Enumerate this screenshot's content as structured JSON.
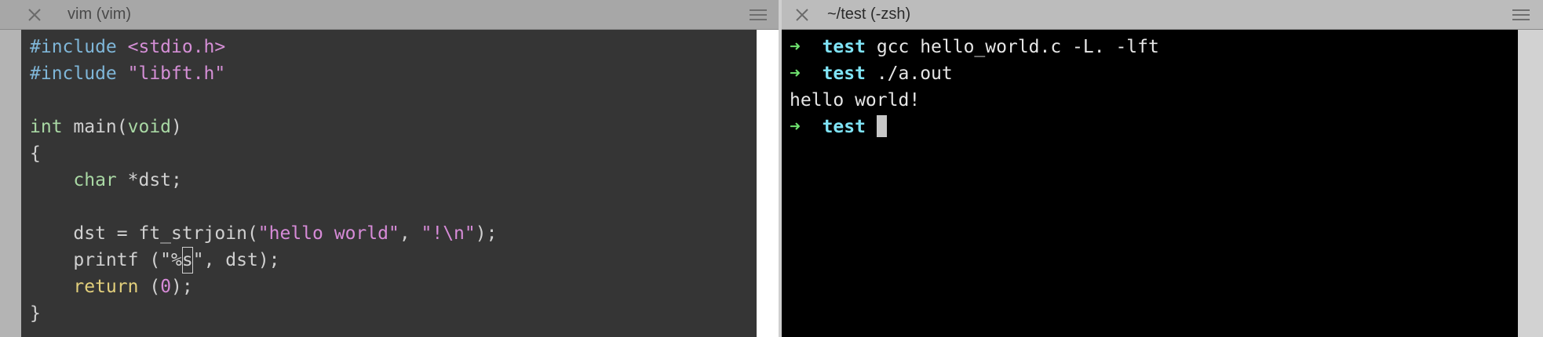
{
  "panes": {
    "left": {
      "tab_title": "vim (vim)",
      "lines": [
        [
          {
            "t": "#include ",
            "c": "pre"
          },
          {
            "t": "<stdio.h>",
            "c": "inc"
          }
        ],
        [
          {
            "t": "#include ",
            "c": "pre"
          },
          {
            "t": "\"libft.h\"",
            "c": "inc"
          }
        ],
        [],
        [
          {
            "t": "int",
            "c": "type"
          },
          {
            "t": " main(",
            "c": "plain"
          },
          {
            "t": "void",
            "c": "type"
          },
          {
            "t": ")",
            "c": "plain"
          }
        ],
        [
          {
            "t": "{",
            "c": "plain"
          }
        ],
        [
          {
            "t": "    ",
            "c": "plain"
          },
          {
            "t": "char",
            "c": "type"
          },
          {
            "t": " *dst;",
            "c": "plain"
          }
        ],
        [],
        [
          {
            "t": "    dst = ft_strjoin(",
            "c": "plain"
          },
          {
            "t": "\"hello world\"",
            "c": "str"
          },
          {
            "t": ", ",
            "c": "plain"
          },
          {
            "t": "\"!\\n\"",
            "c": "str"
          },
          {
            "t": ");",
            "c": "plain"
          }
        ],
        [
          {
            "t": "    printf (\"%",
            "c": "plain"
          },
          {
            "t": "s",
            "c": "cursor"
          },
          {
            "t": "\", dst);",
            "c": "plain"
          }
        ],
        [
          {
            "t": "    ",
            "c": "plain"
          },
          {
            "t": "return",
            "c": "kw"
          },
          {
            "t": " (",
            "c": "plain"
          },
          {
            "t": "0",
            "c": "num"
          },
          {
            "t": ");",
            "c": "plain"
          }
        ],
        [
          {
            "t": "}",
            "c": "plain"
          }
        ]
      ]
    },
    "right": {
      "tab_title": "~/test (-zsh)",
      "prompt_arrow": "➜",
      "prompt_dir": "test",
      "lines": [
        {
          "type": "prompt",
          "cmd": "gcc hello_world.c -L. -lft"
        },
        {
          "type": "prompt",
          "cmd": "./a.out"
        },
        {
          "type": "output",
          "text": "hello world!"
        },
        {
          "type": "prompt",
          "cmd": "",
          "cursor": true
        }
      ]
    }
  },
  "colors": {
    "editor_bg": "#353535",
    "terminal_bg": "#000000",
    "prompt_arrow": "#6ee06e",
    "prompt_dir": "#7fe3f5"
  }
}
